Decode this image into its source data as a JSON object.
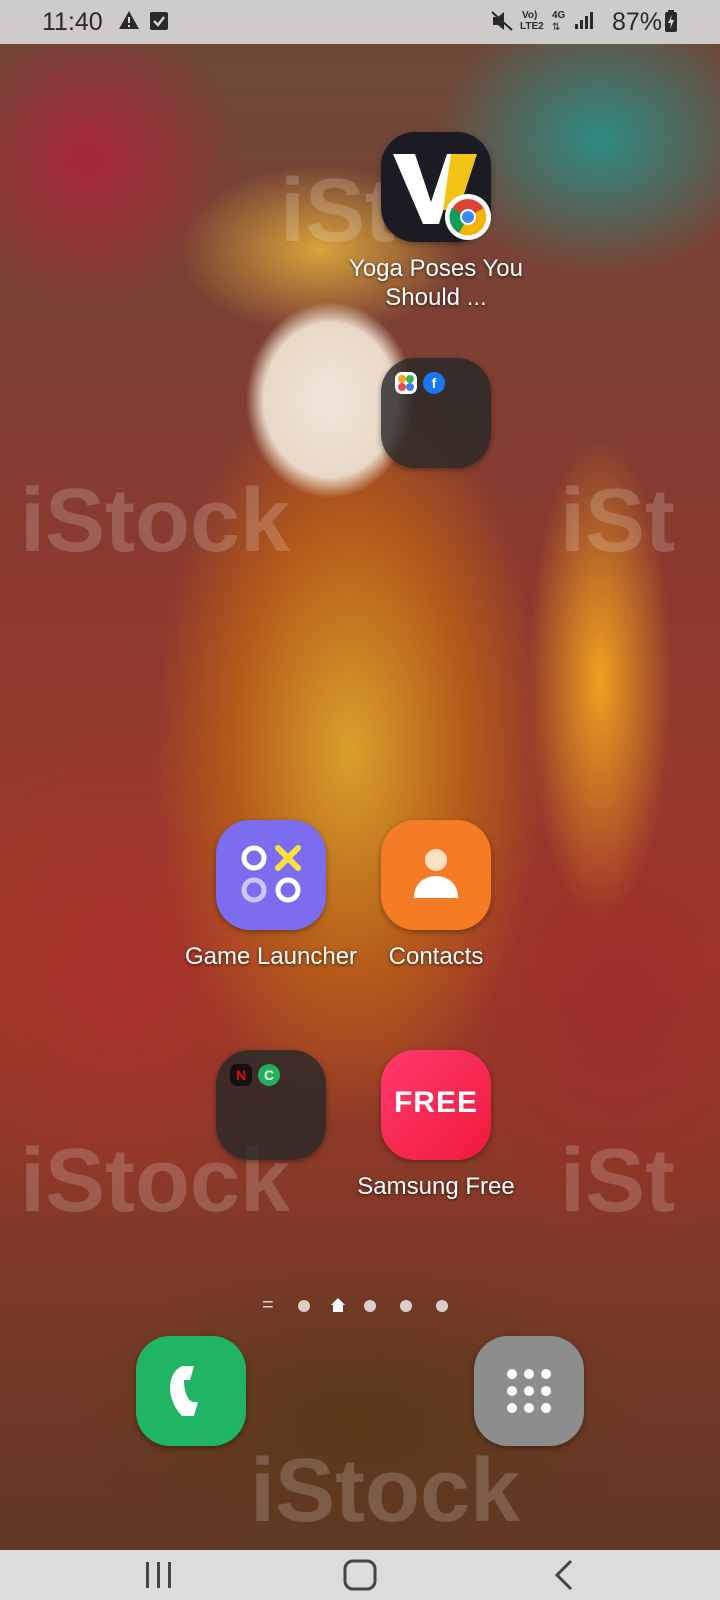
{
  "status_bar": {
    "time": "11:40",
    "signal_label_top": "Vo)",
    "signal_label_bottom": "LTE2",
    "network_type": "4G",
    "battery_percent": "87%"
  },
  "apps": {
    "yoga": {
      "label": "Yoga Poses You Should ...",
      "icon": "webview-w-icon",
      "badge": "chrome-icon"
    },
    "folder_top": {
      "label": "",
      "icons": [
        "collage-icon",
        "facebook-icon"
      ]
    },
    "game_launcher": {
      "label": "Game Launcher",
      "icon": "game-launcher-icon"
    },
    "contacts": {
      "label": "Contacts",
      "icon": "contact-person-icon"
    },
    "folder_bottom": {
      "label": "",
      "icons": [
        "netflix-icon",
        "c-app-icon"
      ],
      "netflix_letter": "N",
      "c_letter": "C"
    },
    "samsung_free": {
      "label": "Samsung Free",
      "icon_text": "FREE"
    }
  },
  "dock": {
    "phone": {
      "icon": "phone-icon"
    },
    "apps_drawer": {
      "icon": "apps-grid-icon"
    }
  },
  "page_indicator": {
    "pages": 5,
    "current": "home",
    "menu_symbol": "="
  },
  "colors": {
    "game_launcher": "#7b6cf0",
    "contacts": "#f57c25",
    "samsung_free": "#f0254e",
    "phone": "#1fb565",
    "apps_drawer": "#8d8d8d"
  }
}
